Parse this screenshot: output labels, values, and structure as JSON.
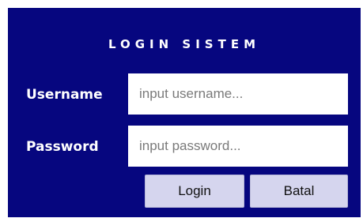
{
  "login": {
    "title": "LOGIN SISTEM",
    "username_label": "Username",
    "username_placeholder": "input username...",
    "username_value": "",
    "password_label": "Password",
    "password_placeholder": "input password...",
    "password_value": "",
    "login_button": "Login",
    "cancel_button": "Batal"
  },
  "colors": {
    "panel_background": "#06067f",
    "button_background": "#d5d5ee",
    "label_text": "#ffffff"
  }
}
